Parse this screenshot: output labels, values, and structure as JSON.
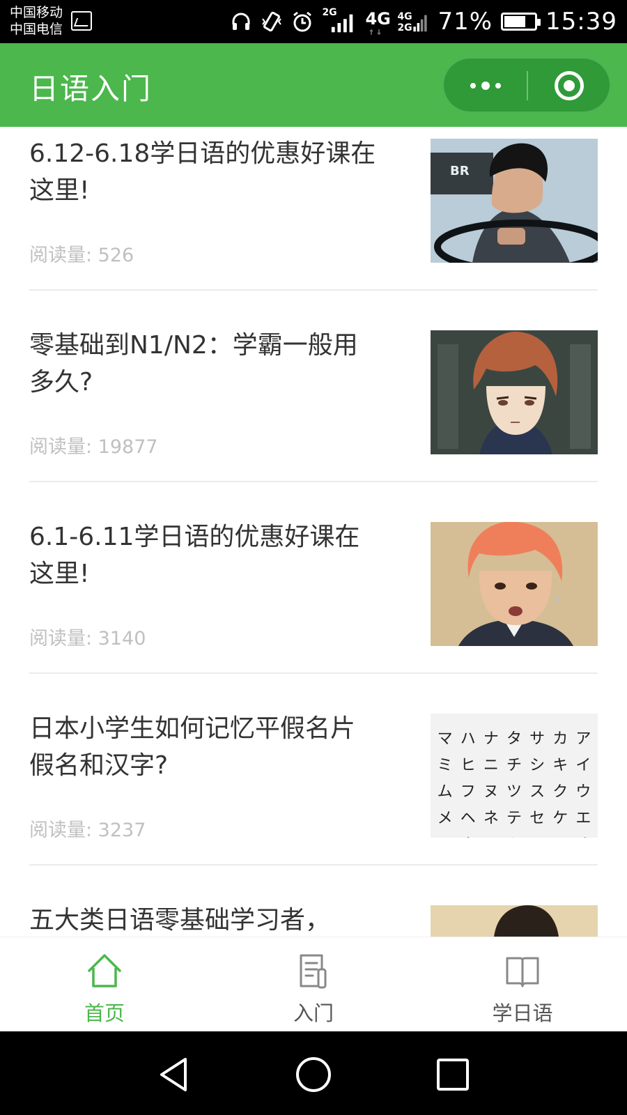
{
  "status_bar": {
    "carrier_1": "中国移动",
    "carrier_2": "中国电信",
    "network_2g": "2G",
    "network_4g": "4G",
    "network_4g2g_top": "4G",
    "network_4g2g_bottom": "2G",
    "battery_percent": "71%",
    "battery_level": 0.71,
    "time": "15:39"
  },
  "app_bar": {
    "title": "日语入门",
    "more_icon": "more-dots-icon",
    "close_icon": "target-circle-icon"
  },
  "articles": [
    {
      "title": "6.12-6.18学日语的优惠好课在这里!",
      "reads_label": "阅读量: 526",
      "thumb": "photo-man-driving"
    },
    {
      "title": "零基础到N1/N2：学霸一般用多久?",
      "reads_label": "阅读量: 19877",
      "thumb": "anime-boy-red-hair"
    },
    {
      "title": "6.1-6.11学日语的优惠好课在这里!",
      "reads_label": "阅读量: 3140",
      "thumb": "photo-man-orange-hair"
    },
    {
      "title": "日本小学生如何记忆平假名片假名和汉字?",
      "reads_label": "阅读量: 3237",
      "thumb": "katakana-chart"
    },
    {
      "title": "五大类日语零基础学习者，",
      "reads_label": "",
      "thumb": "photo-woman"
    }
  ],
  "katakana_rows": [
    [
      "マ",
      "ハ",
      "ナ",
      "タ",
      "サ",
      "カ",
      "ア"
    ],
    [
      "ミ",
      "ヒ",
      "ニ",
      "チ",
      "シ",
      "キ",
      "イ"
    ],
    [
      "ム",
      "フ",
      "ヌ",
      "ツ",
      "ス",
      "ク",
      "ウ"
    ],
    [
      "メ",
      "ヘ",
      "ネ",
      "テ",
      "セ",
      "ケ",
      "エ"
    ],
    [
      "モ",
      "ホ",
      "ノ",
      "ト",
      "ソ",
      "コ",
      "オ"
    ]
  ],
  "tabs": [
    {
      "label": "首页",
      "icon": "home-icon",
      "active": true
    },
    {
      "label": "入门",
      "icon": "document-icon",
      "active": false
    },
    {
      "label": "学日语",
      "icon": "book-icon",
      "active": false
    }
  ],
  "nav_bar": {
    "back_icon": "back-triangle-icon",
    "home_icon": "home-circle-icon",
    "recents_icon": "recents-square-icon"
  },
  "colors": {
    "brand_green": "#4bb74c",
    "capsule_green": "#2f9a37",
    "title_text": "#333333",
    "reads_text": "#c0c0c0",
    "divider": "#ebebeb"
  }
}
